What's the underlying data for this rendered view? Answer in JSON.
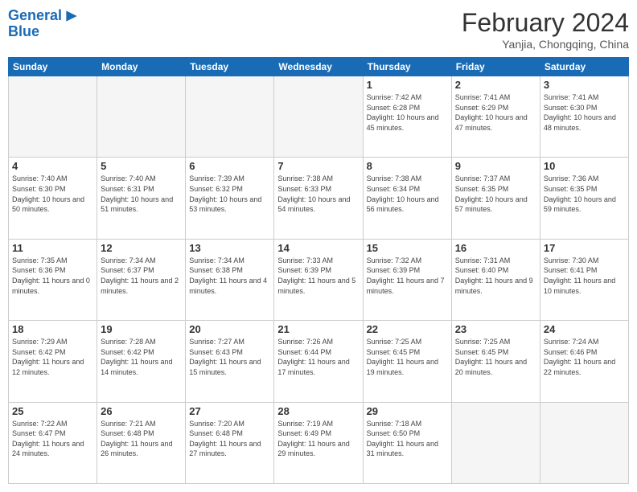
{
  "header": {
    "logo_line1": "General",
    "logo_line2": "Blue",
    "month_title": "February 2024",
    "subtitle": "Yanjia, Chongqing, China"
  },
  "days_of_week": [
    "Sunday",
    "Monday",
    "Tuesday",
    "Wednesday",
    "Thursday",
    "Friday",
    "Saturday"
  ],
  "weeks": [
    [
      {
        "day": "",
        "info": ""
      },
      {
        "day": "",
        "info": ""
      },
      {
        "day": "",
        "info": ""
      },
      {
        "day": "",
        "info": ""
      },
      {
        "day": "1",
        "info": "Sunrise: 7:42 AM\nSunset: 6:28 PM\nDaylight: 10 hours and 45 minutes."
      },
      {
        "day": "2",
        "info": "Sunrise: 7:41 AM\nSunset: 6:29 PM\nDaylight: 10 hours and 47 minutes."
      },
      {
        "day": "3",
        "info": "Sunrise: 7:41 AM\nSunset: 6:30 PM\nDaylight: 10 hours and 48 minutes."
      }
    ],
    [
      {
        "day": "4",
        "info": "Sunrise: 7:40 AM\nSunset: 6:30 PM\nDaylight: 10 hours and 50 minutes."
      },
      {
        "day": "5",
        "info": "Sunrise: 7:40 AM\nSunset: 6:31 PM\nDaylight: 10 hours and 51 minutes."
      },
      {
        "day": "6",
        "info": "Sunrise: 7:39 AM\nSunset: 6:32 PM\nDaylight: 10 hours and 53 minutes."
      },
      {
        "day": "7",
        "info": "Sunrise: 7:38 AM\nSunset: 6:33 PM\nDaylight: 10 hours and 54 minutes."
      },
      {
        "day": "8",
        "info": "Sunrise: 7:38 AM\nSunset: 6:34 PM\nDaylight: 10 hours and 56 minutes."
      },
      {
        "day": "9",
        "info": "Sunrise: 7:37 AM\nSunset: 6:35 PM\nDaylight: 10 hours and 57 minutes."
      },
      {
        "day": "10",
        "info": "Sunrise: 7:36 AM\nSunset: 6:35 PM\nDaylight: 10 hours and 59 minutes."
      }
    ],
    [
      {
        "day": "11",
        "info": "Sunrise: 7:35 AM\nSunset: 6:36 PM\nDaylight: 11 hours and 0 minutes."
      },
      {
        "day": "12",
        "info": "Sunrise: 7:34 AM\nSunset: 6:37 PM\nDaylight: 11 hours and 2 minutes."
      },
      {
        "day": "13",
        "info": "Sunrise: 7:34 AM\nSunset: 6:38 PM\nDaylight: 11 hours and 4 minutes."
      },
      {
        "day": "14",
        "info": "Sunrise: 7:33 AM\nSunset: 6:39 PM\nDaylight: 11 hours and 5 minutes."
      },
      {
        "day": "15",
        "info": "Sunrise: 7:32 AM\nSunset: 6:39 PM\nDaylight: 11 hours and 7 minutes."
      },
      {
        "day": "16",
        "info": "Sunrise: 7:31 AM\nSunset: 6:40 PM\nDaylight: 11 hours and 9 minutes."
      },
      {
        "day": "17",
        "info": "Sunrise: 7:30 AM\nSunset: 6:41 PM\nDaylight: 11 hours and 10 minutes."
      }
    ],
    [
      {
        "day": "18",
        "info": "Sunrise: 7:29 AM\nSunset: 6:42 PM\nDaylight: 11 hours and 12 minutes."
      },
      {
        "day": "19",
        "info": "Sunrise: 7:28 AM\nSunset: 6:42 PM\nDaylight: 11 hours and 14 minutes."
      },
      {
        "day": "20",
        "info": "Sunrise: 7:27 AM\nSunset: 6:43 PM\nDaylight: 11 hours and 15 minutes."
      },
      {
        "day": "21",
        "info": "Sunrise: 7:26 AM\nSunset: 6:44 PM\nDaylight: 11 hours and 17 minutes."
      },
      {
        "day": "22",
        "info": "Sunrise: 7:25 AM\nSunset: 6:45 PM\nDaylight: 11 hours and 19 minutes."
      },
      {
        "day": "23",
        "info": "Sunrise: 7:25 AM\nSunset: 6:45 PM\nDaylight: 11 hours and 20 minutes."
      },
      {
        "day": "24",
        "info": "Sunrise: 7:24 AM\nSunset: 6:46 PM\nDaylight: 11 hours and 22 minutes."
      }
    ],
    [
      {
        "day": "25",
        "info": "Sunrise: 7:22 AM\nSunset: 6:47 PM\nDaylight: 11 hours and 24 minutes."
      },
      {
        "day": "26",
        "info": "Sunrise: 7:21 AM\nSunset: 6:48 PM\nDaylight: 11 hours and 26 minutes."
      },
      {
        "day": "27",
        "info": "Sunrise: 7:20 AM\nSunset: 6:48 PM\nDaylight: 11 hours and 27 minutes."
      },
      {
        "day": "28",
        "info": "Sunrise: 7:19 AM\nSunset: 6:49 PM\nDaylight: 11 hours and 29 minutes."
      },
      {
        "day": "29",
        "info": "Sunrise: 7:18 AM\nSunset: 6:50 PM\nDaylight: 11 hours and 31 minutes."
      },
      {
        "day": "",
        "info": ""
      },
      {
        "day": "",
        "info": ""
      }
    ]
  ]
}
